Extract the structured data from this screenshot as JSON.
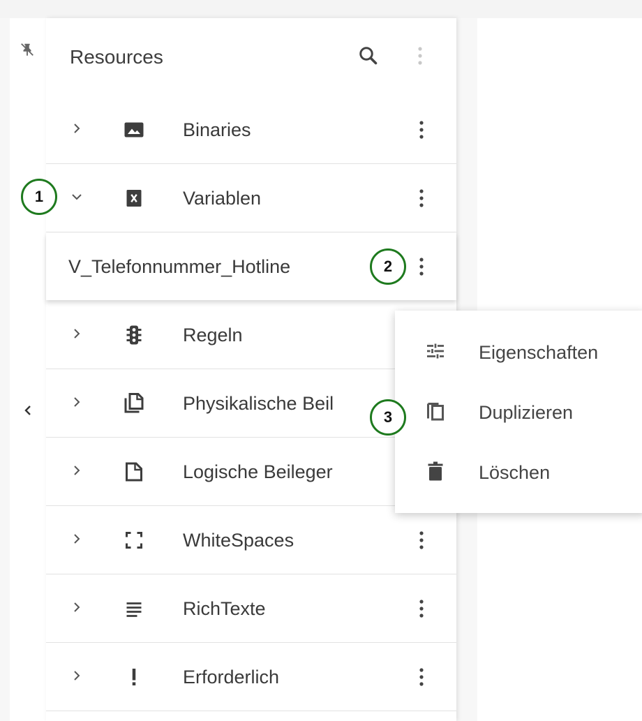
{
  "panel": {
    "title": "Resources",
    "header_icons": [
      "search-icon",
      "more-vert-icon"
    ]
  },
  "left_rail": {
    "icons": [
      "pin-off-icon",
      "chevron-left-icon"
    ]
  },
  "tree": {
    "items": [
      {
        "label": "Binaries",
        "icon": "image-icon",
        "expanded": false
      },
      {
        "label": "Variablen",
        "icon": "variable-icon",
        "expanded": true
      },
      {
        "label": "Regeln",
        "icon": "traffic-light-icon",
        "expanded": false
      },
      {
        "label": "Physikalische Beil",
        "icon": "library-books-icon",
        "expanded": false
      },
      {
        "label": "Logische Beileger",
        "icon": "note-icon",
        "expanded": false
      },
      {
        "label": "WhiteSpaces",
        "icon": "crop-free-icon",
        "expanded": false
      },
      {
        "label": "RichTexte",
        "icon": "subject-icon",
        "expanded": false
      },
      {
        "label": "Erforderlich",
        "icon": "exclamation-icon",
        "expanded": false
      }
    ],
    "child": {
      "label": "V_Telefonnummer_Hotline"
    }
  },
  "context_menu": {
    "items": [
      {
        "label": "Eigenschaften",
        "icon": "tune-icon"
      },
      {
        "label": "Duplizieren",
        "icon": "copy-icon"
      },
      {
        "label": "Löschen",
        "icon": "trash-icon"
      }
    ]
  },
  "callouts": [
    "1",
    "2",
    "3"
  ],
  "colors": {
    "callout_border": "#1e7a1e",
    "icon": "#3d3d3d"
  }
}
